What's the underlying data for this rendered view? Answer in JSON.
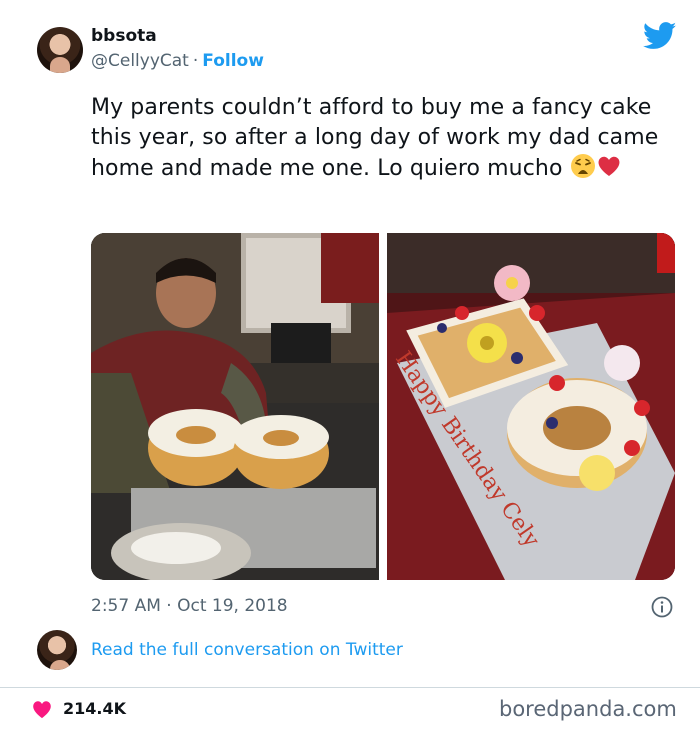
{
  "author": {
    "name": "bbsota",
    "handle": "@CellyyCat",
    "separator": "·",
    "follow_label": "Follow"
  },
  "tweet": {
    "text": "My parents couldn’t afford to buy me a fancy cake this year, so after a long day of work my dad came home and made me one. Lo quiero mucho",
    "emojis": [
      "weary-face",
      "red-heart"
    ]
  },
  "media": {
    "photos": [
      {
        "description_name": "dad-making-cake-photo"
      },
      {
        "description_name": "finished-cake-photo",
        "icing_text": "Happy Birthday Cely"
      }
    ]
  },
  "meta": {
    "timestamp": "2:57 AM · Oct 19, 2018"
  },
  "links": {
    "read_conversation": "Read the full conversation on Twitter"
  },
  "engagement": {
    "likes": "214.4K"
  },
  "footer": {
    "watermark": "boredpanda.com"
  },
  "colors": {
    "twitter_blue": "#1d9bf0",
    "like_red": "#f91880",
    "text_primary": "#0f1419",
    "text_secondary": "#536471"
  },
  "icons": {
    "brand": "twitter-bird-icon",
    "info": "info-icon",
    "like": "heart-icon"
  }
}
